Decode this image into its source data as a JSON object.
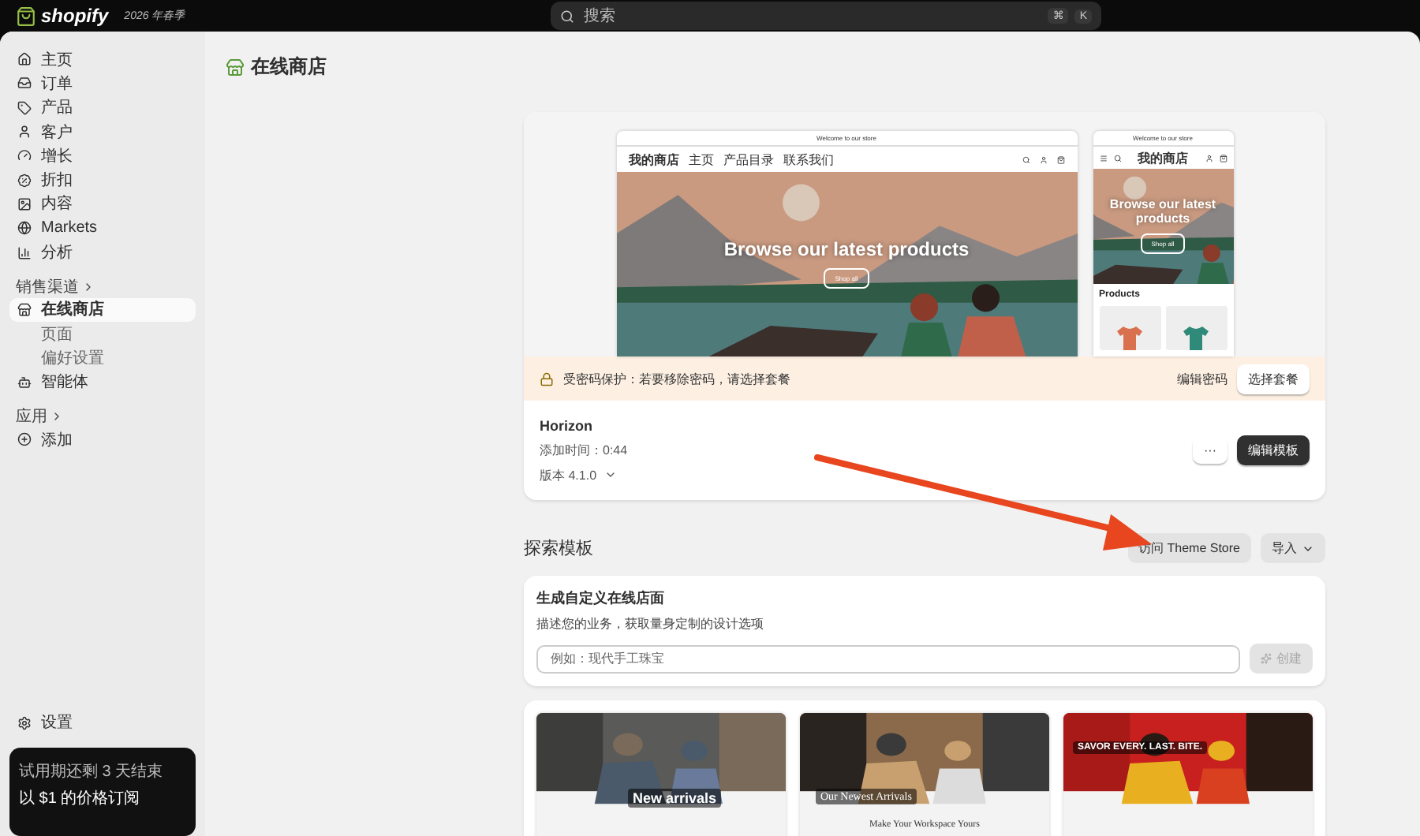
{
  "topbar": {
    "logo": "shopify",
    "edition": "2026 年春季",
    "search": {
      "placeholder": "搜索"
    },
    "shortcut": [
      "⌘",
      "K"
    ]
  },
  "sidebar": {
    "items": [
      {
        "label": "主页",
        "selected": false
      },
      {
        "label": "订单",
        "selected": false
      },
      {
        "label": "产品",
        "selected": false
      },
      {
        "label": "客户",
        "selected": false
      },
      {
        "label": "增长",
        "selected": false
      },
      {
        "label": "折扣",
        "selected": false
      },
      {
        "label": "内容",
        "selected": false
      },
      {
        "label": "Markets",
        "selected": false
      },
      {
        "label": "分析",
        "selected": false
      }
    ],
    "channels": {
      "heading": "销售渠道",
      "items": [
        {
          "label": "在线商店",
          "selected": true,
          "children": [
            {
              "label": "页面",
              "selected": false
            },
            {
              "label": "偏好设置",
              "selected": false
            }
          ]
        },
        {
          "label": "智能体",
          "selected": false
        }
      ]
    },
    "apps": {
      "heading": "应用",
      "items": [
        {
          "label": "添加"
        }
      ]
    },
    "settings": "设置",
    "trial": {
      "line_1": "试用期还剩 3 天结束",
      "line_2": "以 $1 的价格订阅"
    }
  },
  "page": {
    "title": "在线商店",
    "preview": {
      "desktop": {
        "announcement": "Welcome to our store",
        "store_name": "我的商店",
        "nav_links": [
          "主页",
          "产品目录",
          "联系我们"
        ],
        "hero_title": "Browse our latest products",
        "hero_button": "Shop all"
      },
      "mobile": {
        "announcement": "Welcome to our store",
        "store_name": "我的商店",
        "hero_title": "Browse our latest products",
        "hero_button": "Shop all",
        "products_heading": "Products"
      }
    },
    "banner": {
      "text": "受密码保护：若要移除密码，请选择套餐",
      "link": "编辑密码",
      "button": "选择套餐"
    },
    "theme": {
      "name": "Horizon",
      "added": "添加时间：0:44",
      "version": "版本 4.1.0",
      "more": "···",
      "edit": "编辑模板"
    },
    "explore": {
      "title": "探索模板",
      "theme_store": "访问 Theme Store",
      "import": "导入"
    },
    "generate": {
      "title": "生成自定义在线店面",
      "description": "描述您的业务，获取量身定制的设计选项",
      "placeholder": "例如：现代手工珠宝",
      "button": "创建",
      "disabled": true
    },
    "gallery": [
      {
        "hero_text": "New arrivals"
      },
      {
        "hero_text": "Our Newest Arrivals",
        "subtitle": "Make Your Workspace Yours"
      },
      {
        "hero_text": "SAVOR EVERY. LAST. BITE."
      }
    ]
  }
}
